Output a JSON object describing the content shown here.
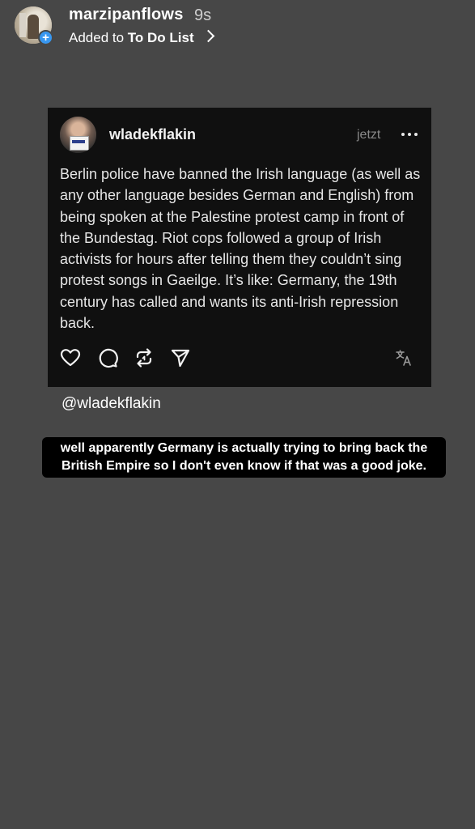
{
  "story": {
    "username": "marzipanflows",
    "timestamp": "9s",
    "added_prefix": "Added to",
    "list_name": "To Do List"
  },
  "post": {
    "author": "wladekflakin",
    "time": "jetzt",
    "body": "Berlin police have banned the Irish language (as well as any other language besides German and English) from being spoken at the Palestine protest camp in front of the Bundestag. Riot cops followed a group of Irish activists for hours after telling them they couldn’t sing protest songs in Gaeilge. It’s like: Germany, the 19th century has called and wants its anti-Irish repression back.",
    "icons": [
      "heart-icon",
      "comment-icon",
      "repost-icon",
      "share-icon",
      "translate-icon"
    ]
  },
  "mention": "@wladekflakin",
  "caption": "well apparently Germany is actually trying to bring back the British Empire so I don't even know if that was a good joke.",
  "colors": {
    "background": "#474747",
    "card": "#101010",
    "badge": "#3897f0"
  }
}
